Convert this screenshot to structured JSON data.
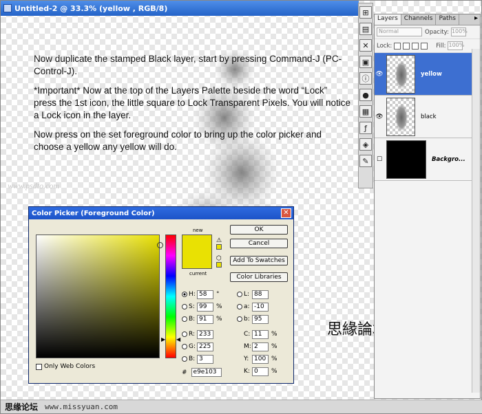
{
  "document": {
    "title": "Untitled-2 @ 33.3% (yellow , RGB/8)"
  },
  "tutorial": {
    "para1": "Now duplicate the stamped Black layer, start by pressing Command-J (PC- Control-J).",
    "para2": "*Important* Now at the top of the Layers Palette beside the word “Lock” press the 1st icon, the little square to Lock Transparent Pixels. You will notice a Lock icon in the layer.",
    "para3": "Now press on the set foreground color to bring up the color picker and choose a yellow any yellow will do."
  },
  "watermark": "www.psdto.com",
  "chinese_title": "思緣論壇翻譯",
  "footer": {
    "forum": "思缘论坛",
    "site": "www.missyuan.com"
  },
  "layers_panel": {
    "tabs": [
      "Layers",
      "Channels",
      "Paths"
    ],
    "blend_mode": "Normal",
    "opacity_label": "Opacity:",
    "opacity_value": "100%",
    "lock_label": "Lock:",
    "fill_label": "Fill:",
    "fill_value": "100%",
    "layers": [
      {
        "name": "yellow",
        "selected": true
      },
      {
        "name": "black",
        "selected": false
      },
      {
        "name": "Backgro...",
        "selected": false
      }
    ]
  },
  "color_picker": {
    "title": "Color Picker (Foreground Color)",
    "new_label": "new",
    "current_label": "current",
    "buttons": {
      "ok": "OK",
      "cancel": "Cancel",
      "add_swatches": "Add To Swatches",
      "libraries": "Color Libraries"
    },
    "only_web_colors": "Only Web Colors",
    "hsb": {
      "H": "58",
      "S": "99",
      "B": "91"
    },
    "hsb_units": {
      "H": "°",
      "S": "%",
      "B": "%"
    },
    "rgb": {
      "R": "233",
      "G": "225",
      "B": "3"
    },
    "lab": {
      "L": "88",
      "a": "-10",
      "b": "95"
    },
    "cmyk": {
      "C": "11",
      "M": "2",
      "Y": "100",
      "K": "0"
    },
    "cmyk_unit": "%",
    "hex_label": "#",
    "hex": "e9e103",
    "color": "#e9e103"
  }
}
